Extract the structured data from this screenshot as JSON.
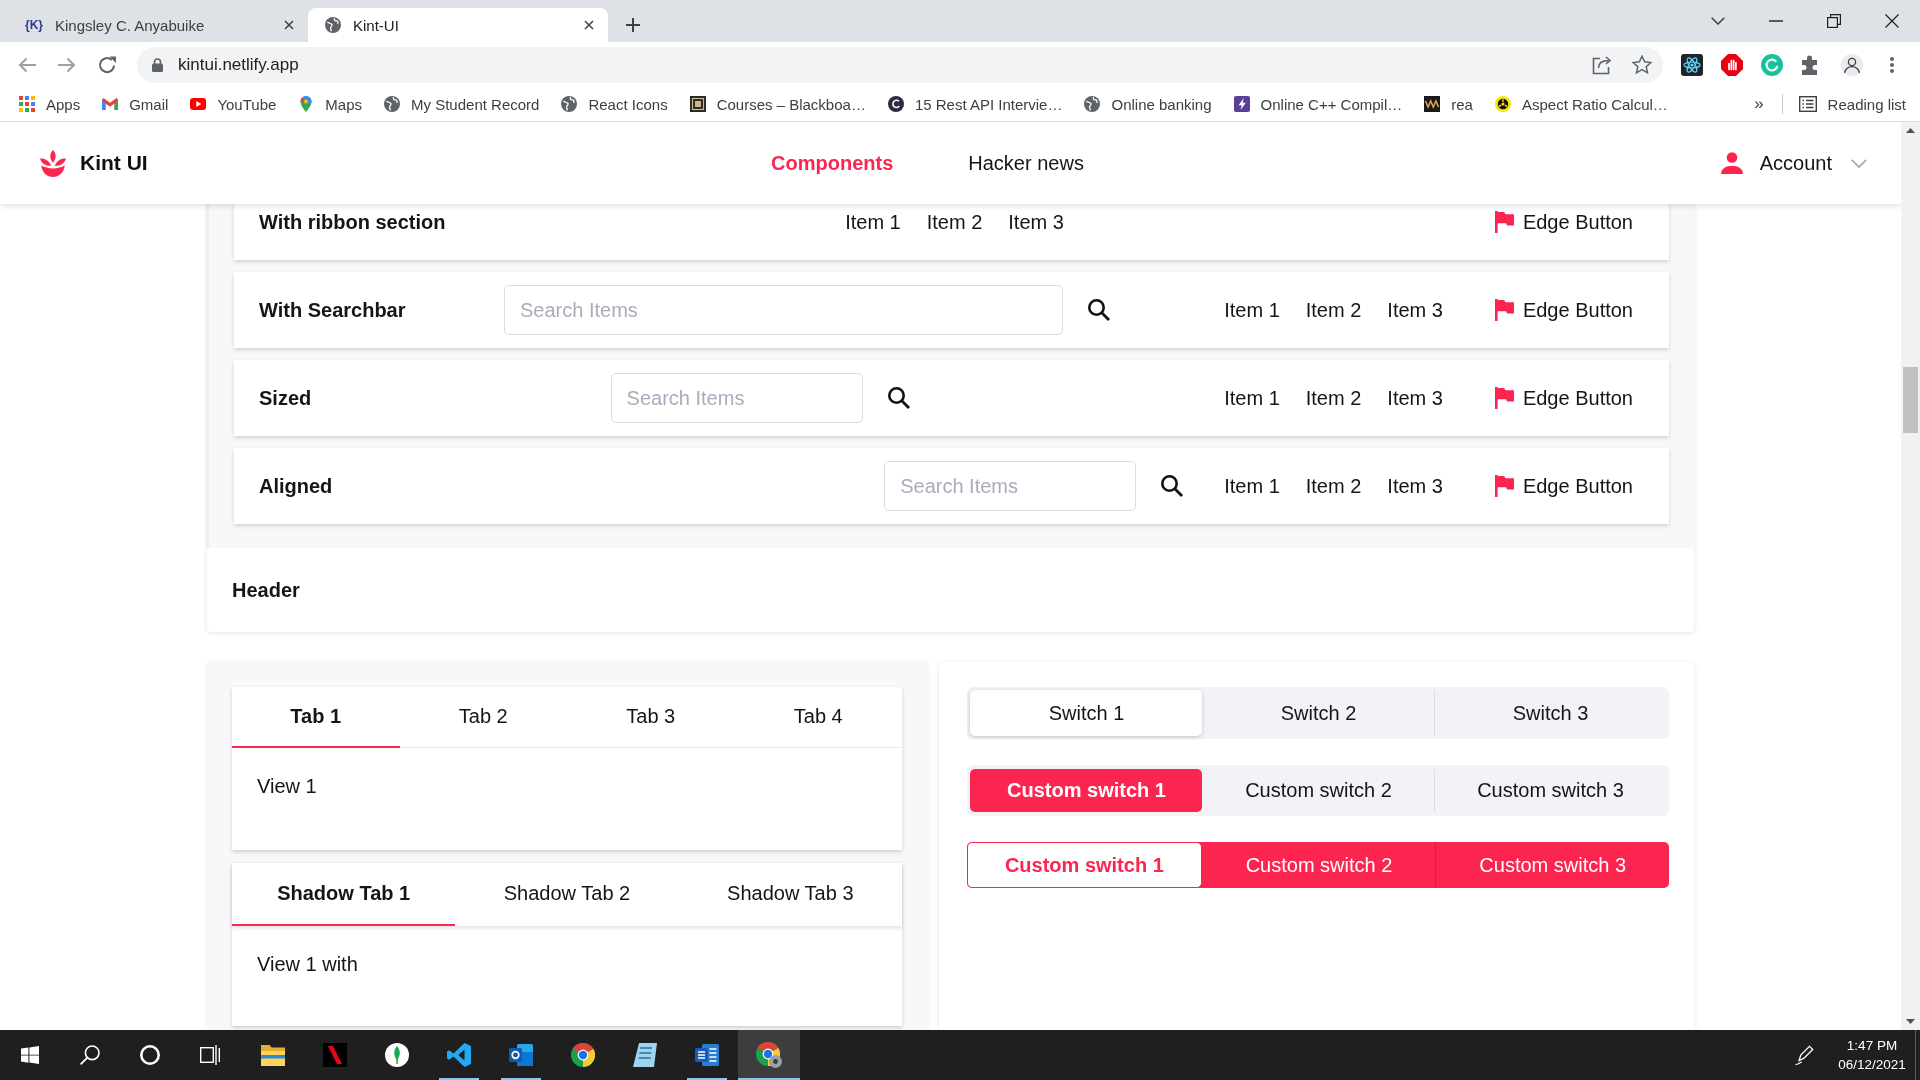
{
  "browser": {
    "tabs": [
      {
        "favicon_text": "{K}",
        "title": "Kingsley C. Anyabuike",
        "selected": false
      },
      {
        "title": "Kint-UI",
        "selected": true
      }
    ],
    "url": "kintui.netlify.app",
    "bookmarks": [
      "Apps",
      "Gmail",
      "YouTube",
      "Maps",
      "My Student Record",
      "React Icons",
      "Courses – Blackboa…",
      "15 Rest API Intervie…",
      "Online banking",
      "Online C++ Compil…",
      "rea",
      "Aspect Ratio Calcul…"
    ],
    "bookmarks_overflow": "»",
    "reading_list": "Reading list"
  },
  "app": {
    "brand": "Kint UI",
    "nav": [
      {
        "label": "Components",
        "selected": true
      },
      {
        "label": "Hacker news",
        "selected": false
      }
    ],
    "account": "Account"
  },
  "ribbons": [
    {
      "kind": "plain",
      "title": "With ribbon section",
      "items": [
        "Item 1",
        "Item 2",
        "Item 3"
      ],
      "edge_button": "Edge Button"
    },
    {
      "kind": "searchbar",
      "title": "With Searchbar",
      "placeholder": "Search Items",
      "items": [
        "Item 1",
        "Item 2",
        "Item 3"
      ],
      "edge_button": "Edge Button"
    },
    {
      "kind": "sized",
      "title": "Sized",
      "placeholder": "Search Items",
      "items": [
        "Item 1",
        "Item 2",
        "Item 3"
      ],
      "edge_button": "Edge Button"
    },
    {
      "kind": "aligned",
      "title": "Aligned",
      "placeholder": "Search Items",
      "items": [
        "Item 1",
        "Item 2",
        "Item 3"
      ],
      "edge_button": "Edge Button"
    }
  ],
  "section_footer": {
    "title": "Header"
  },
  "tab_panels": [
    {
      "kind": "plain",
      "tabs": [
        {
          "label": "Tab 1",
          "selected": true
        },
        {
          "label": "Tab 2",
          "selected": false
        },
        {
          "label": "Tab 3",
          "selected": false
        },
        {
          "label": "Tab 4",
          "selected": false
        }
      ],
      "view": "View 1"
    },
    {
      "kind": "shadow",
      "tabs": [
        {
          "label": "Shadow Tab 1",
          "selected": true
        },
        {
          "label": "Shadow Tab 2",
          "selected": false
        },
        {
          "label": "Shadow Tab 3",
          "selected": false
        }
      ],
      "view": "View 1 with"
    }
  ],
  "switch_groups": [
    {
      "kind": "default",
      "options": [
        {
          "label": "Switch 1",
          "selected": true
        },
        {
          "label": "Switch 2",
          "selected": false
        },
        {
          "label": "Switch 3",
          "selected": false
        }
      ]
    },
    {
      "kind": "filled",
      "options": [
        {
          "label": "Custom switch 1",
          "selected": true
        },
        {
          "label": "Custom switch 2",
          "selected": false
        },
        {
          "label": "Custom switch 3",
          "selected": false
        }
      ]
    },
    {
      "kind": "outline",
      "options": [
        {
          "label": "Custom switch 1",
          "selected": true
        },
        {
          "label": "Custom switch 2",
          "selected": false
        },
        {
          "label": "Custom switch 3",
          "selected": false
        }
      ]
    }
  ],
  "taskbar": {
    "apps": [
      {
        "running": false,
        "selected": false
      },
      {
        "running": false,
        "selected": false
      },
      {
        "running": false,
        "selected": false
      },
      {
        "running": true,
        "selected": false
      },
      {
        "running": true,
        "selected": false
      },
      {
        "running": false,
        "selected": false
      },
      {
        "running": false,
        "selected": false
      },
      {
        "running": true,
        "selected": false
      },
      {
        "running": true,
        "selected": true
      }
    ],
    "time": "1:47 PM",
    "date": "06/12/2021"
  }
}
